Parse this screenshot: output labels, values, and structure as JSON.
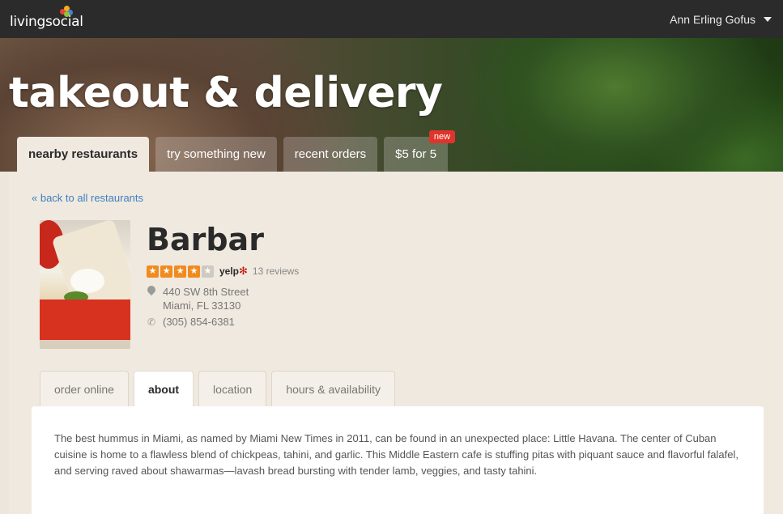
{
  "topbar": {
    "logo_text": "livingsocial",
    "user_name": "Ann Erling Gofus"
  },
  "hero": {
    "title": "takeout & delivery"
  },
  "main_tabs": [
    {
      "label": "nearby restaurants",
      "active": true
    },
    {
      "label": "try something new",
      "active": false
    },
    {
      "label": "recent orders",
      "active": false
    },
    {
      "label": "$5 for 5",
      "active": false,
      "badge": "new"
    }
  ],
  "back_link": "« back to all restaurants",
  "restaurant": {
    "name": "Barbar",
    "rating": 4,
    "rating_max": 5,
    "rating_source": "yelp",
    "reviews": "13 reviews",
    "address_line1": "440 SW 8th Street",
    "address_line2": "Miami, FL 33130",
    "phone": "(305) 854-6381"
  },
  "sub_tabs": [
    {
      "label": "order online",
      "active": false
    },
    {
      "label": "about",
      "active": true
    },
    {
      "label": "location",
      "active": false
    },
    {
      "label": "hours & availability",
      "active": false
    }
  ],
  "about_text": "The best hummus in Miami, as named by Miami New Times in 2011, can be found in an unexpected place: Little Havana. The center of Cuban cuisine is home to a flawless blend of chickpeas, tahini, and garlic. This Middle Eastern cafe is stuffing pitas with piquant sauce and flavorful falafel, and serving raved about shawarmas—lavash bread bursting with tender lamb, veggies, and tasty tahini.",
  "colors": {
    "topbar": "#2b2b2b",
    "link": "#3f7fbf",
    "star": "#f18b1f",
    "badge": "#e0342b"
  }
}
